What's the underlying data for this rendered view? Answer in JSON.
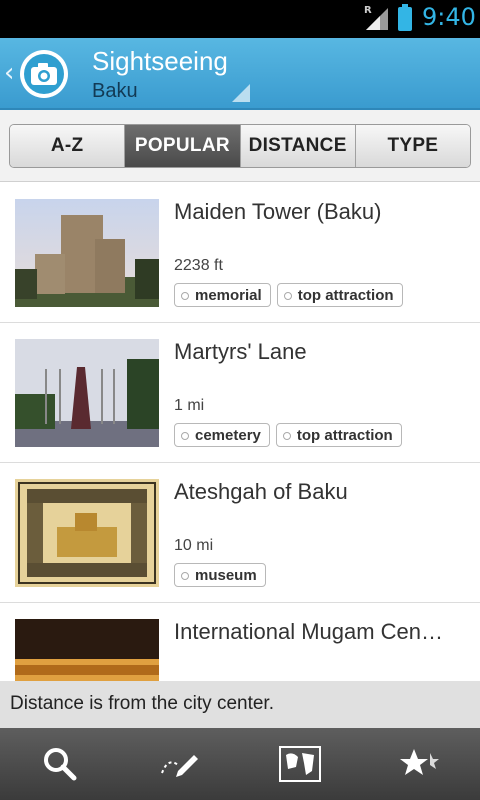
{
  "status_bar": {
    "time": "9:40",
    "network_indicator": "R"
  },
  "action_bar": {
    "title": "Sightseeing",
    "subtitle": "Baku"
  },
  "tabs": [
    {
      "label": "A-Z",
      "active": false
    },
    {
      "label": "POPULAR",
      "active": true
    },
    {
      "label": "DISTANCE",
      "active": false
    },
    {
      "label": "TYPE",
      "active": false
    }
  ],
  "items": [
    {
      "title": "Maiden Tower (Baku)",
      "distance": "2238 ft",
      "tags": [
        "memorial",
        "top attraction"
      ]
    },
    {
      "title": "Martyrs' Lane",
      "distance": "1 mi",
      "tags": [
        "cemetery",
        "top attraction"
      ]
    },
    {
      "title": "Ateshgah of Baku",
      "distance": "10 mi",
      "tags": [
        "museum"
      ]
    },
    {
      "title": "International Mugam Cen…",
      "distance": "",
      "tags": []
    }
  ],
  "footer_note": "Distance is from the city center.",
  "bottom_bar": [
    "search-icon",
    "edit-icon",
    "map-icon",
    "favorites-icon"
  ],
  "colors": {
    "accent": "#33b5e5",
    "action_bar": "#3a9bcf"
  }
}
